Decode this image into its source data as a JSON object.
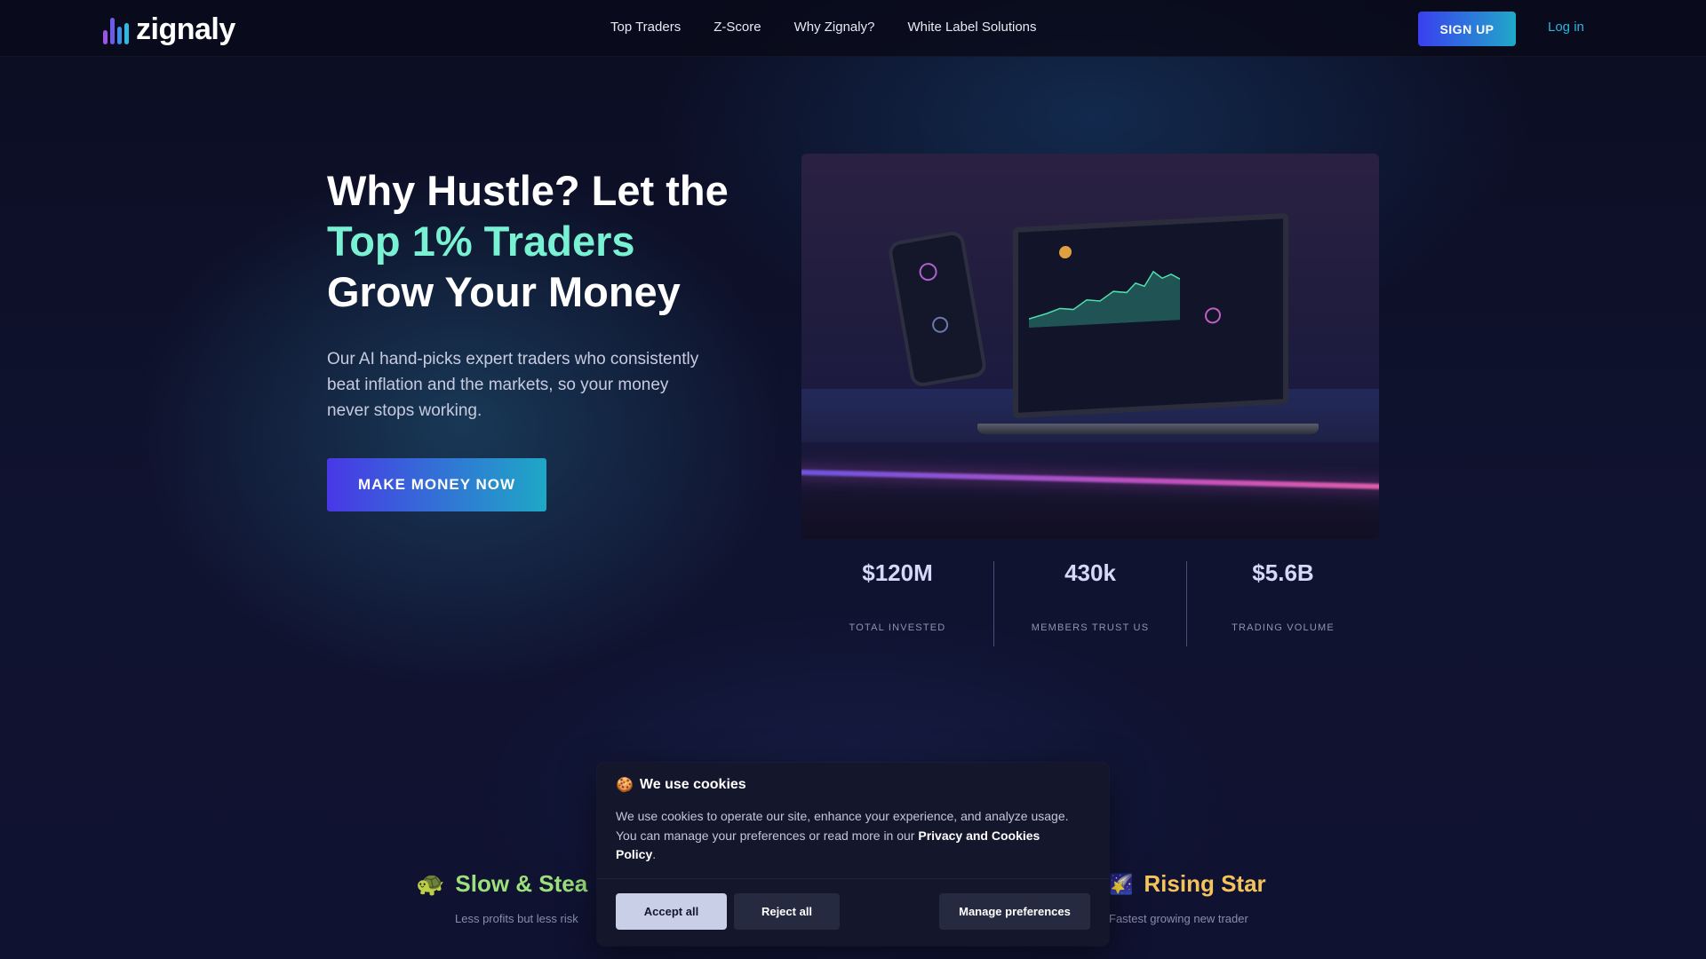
{
  "brand": {
    "name": "zignaly",
    "colors": [
      "#5b5ce8",
      "#2fb9e0",
      "#9a55e6",
      "#ffffff"
    ]
  },
  "nav": {
    "links": [
      "Top Traders",
      "Z-Score",
      "Why Zignaly?",
      "White Label Solutions"
    ],
    "signup_label": "SIGN UP",
    "login_label": "Log in"
  },
  "hero": {
    "title_line1": "Why Hustle? Let the",
    "title_highlight": "Top 1% Traders",
    "title_line3": "Grow Your Money",
    "description": "Our AI hand-picks expert traders who consistently beat inflation and the markets, so your money never stops working.",
    "cta_label": "MAKE MONEY NOW",
    "image_icon": "laptop-phone-dashboard-illustration"
  },
  "stats": [
    {
      "value": "$120M",
      "label": "TOTAL INVESTED"
    },
    {
      "value": "430k",
      "label": "MEMBERS TRUST US"
    },
    {
      "value": "$5.6B",
      "label": "TRADING VOLUME"
    }
  ],
  "categories": [
    {
      "icon": "turtle-icon",
      "title": "Slow & Stea",
      "subtitle": "Less profits but less risk",
      "color": "#9be07a"
    },
    {
      "icon": "shooting-star-icon",
      "title": "Rising Star",
      "subtitle": "Fastest growing new trader",
      "color": "#f4c35a"
    }
  ],
  "cookie_banner": {
    "icon": "cookie-icon",
    "title": "We use cookies",
    "body_text": "We use cookies to operate our site, enhance your experience, and analyze usage. You can manage your preferences or read more in our",
    "policy_link": "Privacy and Cookies Policy",
    "body_end": ".",
    "accept_label": "Accept all",
    "reject_label": "Reject all",
    "manage_label": "Manage preferences"
  },
  "accent_colors": {
    "highlight": "#79f2d3",
    "link": "#29b6e2",
    "cta_start": "#4838e6",
    "cta_end": "#1ea8c6"
  }
}
